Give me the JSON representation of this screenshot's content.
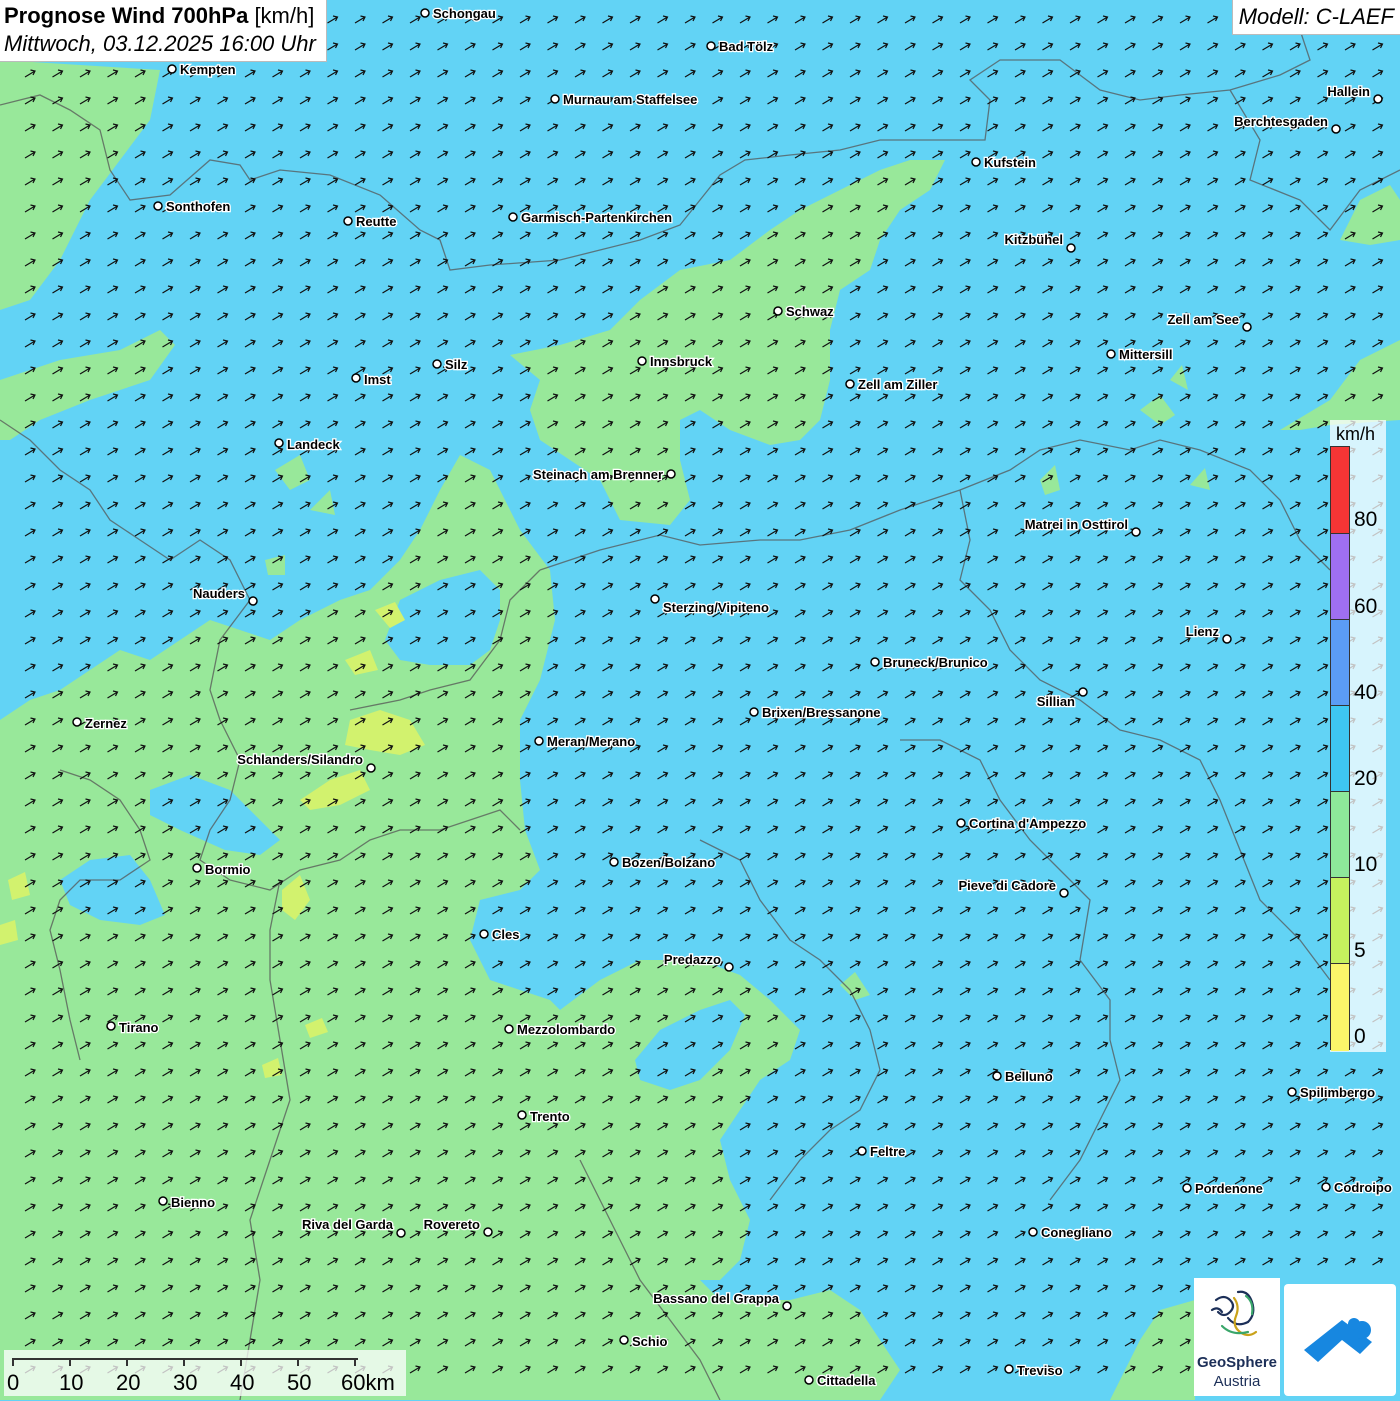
{
  "title": {
    "main": "Prognose Wind 700hPa",
    "unit": "[km/h]",
    "datetime": "Mittwoch, 03.12.2025 16:00 Uhr"
  },
  "model": "Modell: C-LAEF",
  "legend": {
    "unit": "km/h",
    "labels": [
      "80",
      "60",
      "40",
      "20",
      "10",
      "5",
      "0"
    ],
    "colors": [
      "#f53535",
      "#9f6ff2",
      "#5b9cf5",
      "#3ec7f2",
      "#8ee89a",
      "#c6f25e",
      "#fbf66a"
    ]
  },
  "scalebar": {
    "labels": [
      "0",
      "10",
      "20",
      "30",
      "40",
      "50",
      "60km"
    ]
  },
  "logo": {
    "name": "GeoSphere",
    "sub": "Austria",
    "icon": "geosphere-logo-icon",
    "app_icon": "wind-app-icon"
  },
  "cities": [
    "Schongau",
    "Bad Tölz",
    "Kempten",
    "Murnau am Staffelsee",
    "Hallein",
    "Berchtesgaden",
    "Kufstein",
    "Sonthofen",
    "Reutte",
    "Garmisch-Partenkirchen",
    "Kitzbühel",
    "Schwaz",
    "Zell am See",
    "Mittersill",
    "Innsbruck",
    "Zell am Ziller",
    "Imst",
    "Silz",
    "Landeck",
    "Steinach am Brenner",
    "Matrei in Osttirol",
    "Nauders",
    "Sterzing/Vipiteno",
    "Lienz",
    "Bruneck/Brunico",
    "Zernez",
    "Sillian",
    "Brixen/Bressanone",
    "Meran/Merano",
    "Schlanders/Silandro",
    "Cortina d'Ampezzo",
    "Bozen/Bolzano",
    "Bormio",
    "Pieve di Cadore",
    "Cles",
    "Predazzo",
    "Tirano",
    "Mezzolombardo",
    "Belluno",
    "Spilimbergo",
    "Trento",
    "Feltre",
    "Pordenone",
    "Codroipo",
    "Bienno",
    "Riva del Garda",
    "Rovereto",
    "Conegliano",
    "Bassano del Grappa",
    "Schio",
    "Treviso",
    "Cittadella"
  ],
  "colors": {
    "wind_10_20": "#62d3f5",
    "wind_5_10": "#98e89a",
    "wind_0_5": "#d2f26e",
    "border": "#555555",
    "arrow": "#111111"
  }
}
